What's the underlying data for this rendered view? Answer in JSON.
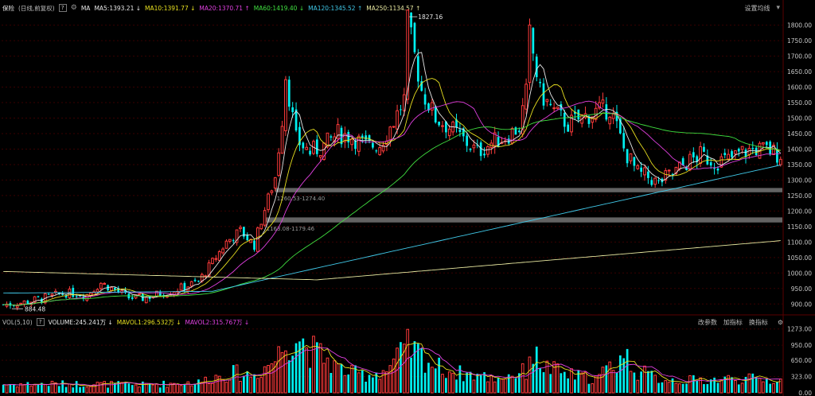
{
  "header": {
    "symbol": "保险",
    "period_mode": "(日线,前复权)",
    "help_glyph": "?",
    "settings_glyph": "⚙",
    "indicator": "MA",
    "ma_items": [
      {
        "label": "MA5:1393.21",
        "arrow": "↓",
        "color": "#e8e8e8"
      },
      {
        "label": "MA10:1391.77",
        "arrow": "↓",
        "color": "#e8e020"
      },
      {
        "label": "MA20:1370.71",
        "arrow": "↑",
        "color": "#e040e0"
      },
      {
        "label": "MA60:1419.40",
        "arrow": "↓",
        "color": "#40e040"
      },
      {
        "label": "MA120:1345.52",
        "arrow": "↑",
        "color": "#40c8e8"
      },
      {
        "label": "MA250:1134.57",
        "arrow": "↑",
        "color": "#e8e8a0"
      }
    ],
    "settings_link": "设置均线",
    "dropdown_glyph": "▾"
  },
  "volume_header": {
    "label": "VOL(5,10)",
    "help_glyph": "?",
    "volume": "VOLUME:245.241万",
    "volume_arrow": "↓",
    "mavol1": "MAVOL1:296.532万",
    "mavol1_arrow": "↓",
    "mavol2": "MAVOL2:315.767万",
    "mavol2_arrow": "↓",
    "tools": [
      "改参数",
      "加指标",
      "换指标"
    ],
    "settings_glyph": "⚙"
  },
  "colors": {
    "up": "#ff3b3b",
    "down": "#00f0f0",
    "grid": "#3a0000",
    "axis_text": "#c8c8c8",
    "ma5": "#e8e8e8",
    "ma10": "#e8e020",
    "ma20": "#e040e0",
    "ma60": "#40e040",
    "ma120": "#40c8e8",
    "ma250": "#e8e8a0"
  },
  "chart_data": {
    "type": "candlestick",
    "y_ticks": [
      900,
      950,
      1000,
      1050,
      1100,
      1150,
      1200,
      1250,
      1300,
      1350,
      1400,
      1450,
      1500,
      1550,
      1600,
      1650,
      1700,
      1750,
      1800
    ],
    "y_tick_labels": [
      "900.00",
      "950.00",
      "1000.00",
      "1050.00",
      "1100.00",
      "1150.00",
      "1200.00",
      "1250.00",
      "1300.00",
      "1350.00",
      "1400.00",
      "1450.00",
      "1500.00",
      "1550.00",
      "1600.00",
      "1650.00",
      "1700.00",
      "1750.00",
      "1800.00"
    ],
    "ylim": [
      875,
      1835
    ],
    "annotations": {
      "high": {
        "value": 1827.16,
        "label": "1827.16"
      },
      "low": {
        "value": 884.48,
        "label": "884.48"
      }
    },
    "zones": [
      {
        "low": 1260.53,
        "high": 1274.4,
        "label": "1260.53-1274.40"
      },
      {
        "low": 1163.08,
        "high": 1179.46,
        "label": "1163.08-1179.46"
      }
    ],
    "keypoints": [
      [
        0,
        898
      ],
      [
        6,
        905
      ],
      [
        12,
        920
      ],
      [
        18,
        935
      ],
      [
        24,
        930
      ],
      [
        28,
        968
      ],
      [
        32,
        945
      ],
      [
        36,
        920
      ],
      [
        40,
        918
      ],
      [
        44,
        930
      ],
      [
        48,
        942
      ],
      [
        52,
        955
      ],
      [
        56,
        972
      ],
      [
        60,
        1035
      ],
      [
        64,
        1100
      ],
      [
        68,
        1135
      ],
      [
        72,
        1090
      ],
      [
        74,
        1170
      ],
      [
        78,
        1310
      ],
      [
        80,
        1500
      ],
      [
        81,
        1640
      ],
      [
        84,
        1430
      ],
      [
        88,
        1390
      ],
      [
        92,
        1410
      ],
      [
        96,
        1450
      ],
      [
        100,
        1440
      ],
      [
        104,
        1410
      ],
      [
        108,
        1415
      ],
      [
        112,
        1490
      ],
      [
        115,
        1560
      ],
      [
        116,
        1810
      ],
      [
        120,
        1590
      ],
      [
        124,
        1500
      ],
      [
        128,
        1470
      ],
      [
        132,
        1430
      ],
      [
        136,
        1390
      ],
      [
        140,
        1420
      ],
      [
        144,
        1440
      ],
      [
        148,
        1470
      ],
      [
        150,
        1580
      ],
      [
        151,
        1770
      ],
      [
        154,
        1580
      ],
      [
        158,
        1520
      ],
      [
        162,
        1480
      ],
      [
        166,
        1500
      ],
      [
        170,
        1520
      ],
      [
        174,
        1530
      ],
      [
        176,
        1470
      ],
      [
        178,
        1400
      ],
      [
        182,
        1320
      ],
      [
        186,
        1305
      ],
      [
        188,
        1290
      ],
      [
        192,
        1320
      ],
      [
        196,
        1355
      ],
      [
        200,
        1380
      ],
      [
        204,
        1360
      ],
      [
        208,
        1365
      ],
      [
        212,
        1390
      ],
      [
        216,
        1400
      ],
      [
        220,
        1395
      ],
      [
        222,
        1385
      ]
    ],
    "volume": {
      "y_ticks": [
        0,
        323,
        650,
        950,
        1273
      ],
      "y_tick_labels": [
        "0.00",
        "323.00",
        "650.00",
        "950.00",
        "1273.00"
      ],
      "ylim": [
        0,
        1300
      ],
      "keypoints": [
        [
          0,
          180
        ],
        [
          20,
          190
        ],
        [
          40,
          170
        ],
        [
          56,
          220
        ],
        [
          60,
          320
        ],
        [
          66,
          420
        ],
        [
          72,
          380
        ],
        [
          78,
          700
        ],
        [
          82,
          1150
        ],
        [
          84,
          1250
        ],
        [
          88,
          900
        ],
        [
          92,
          750
        ],
        [
          96,
          520
        ],
        [
          100,
          420
        ],
        [
          104,
          380
        ],
        [
          110,
          480
        ],
        [
          116,
          950
        ],
        [
          120,
          780
        ],
        [
          124,
          560
        ],
        [
          130,
          420
        ],
        [
          136,
          380
        ],
        [
          140,
          300
        ],
        [
          150,
          450
        ],
        [
          151,
          860
        ],
        [
          156,
          520
        ],
        [
          162,
          380
        ],
        [
          170,
          300
        ],
        [
          176,
          650
        ],
        [
          178,
          820
        ],
        [
          182,
          450
        ],
        [
          188,
          300
        ],
        [
          196,
          260
        ],
        [
          204,
          280
        ],
        [
          212,
          300
        ],
        [
          222,
          260
        ]
      ]
    },
    "seed": 7
  }
}
